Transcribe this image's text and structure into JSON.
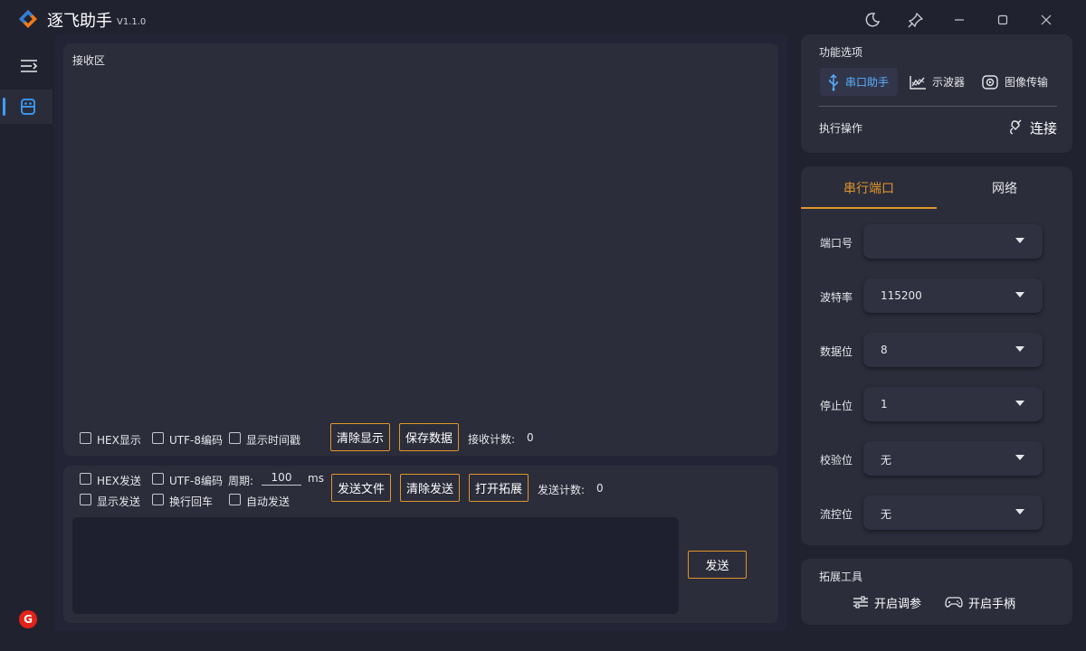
{
  "window": {
    "title": "逐飞助手",
    "version": "V1.1.0"
  },
  "receive": {
    "title": "接收区",
    "options": [
      {
        "label": "HEX显示",
        "checked": false
      },
      {
        "label": "UTF-8编码",
        "checked": false
      },
      {
        "label": "显示时间戳",
        "checked": false
      }
    ],
    "clear_button": "清除显示",
    "save_button": "保存数据",
    "count_label": "接收计数:",
    "count_value": "0"
  },
  "send": {
    "options_row1": [
      {
        "label": "HEX发送",
        "checked": false
      },
      {
        "label": "UTF-8编码",
        "checked": false
      }
    ],
    "period_label": "周期:",
    "period_value": "100",
    "period_unit": "ms",
    "options_row2": [
      {
        "label": "显示发送",
        "checked": false
      },
      {
        "label": "换行回车",
        "checked": false
      },
      {
        "label": "自动发送",
        "checked": false
      }
    ],
    "send_file_button": "发送文件",
    "clear_send_button": "清除发送",
    "open_ext_button": "打开拓展",
    "count_label": "发送计数:",
    "count_value": "0",
    "send_button": "发送",
    "input_value": ""
  },
  "functions": {
    "title": "功能选项",
    "tabs": [
      "串口助手",
      "示波器",
      "图像传输"
    ],
    "active_tab": "串口助手",
    "action_label": "执行操作",
    "connect_button": "连接"
  },
  "settings": {
    "tabs": [
      "串行端口",
      "网络"
    ],
    "active_tab": "串行端口",
    "fields": [
      {
        "label": "端口号",
        "value": ""
      },
      {
        "label": "波特率",
        "value": "115200"
      },
      {
        "label": "数据位",
        "value": "8"
      },
      {
        "label": "停止位",
        "value": "1"
      },
      {
        "label": "校验位",
        "value": "无"
      },
      {
        "label": "流控位",
        "value": "无"
      }
    ]
  },
  "extensions": {
    "title": "拓展工具",
    "tuning_button": "开启调参",
    "gamepad_button": "开启手柄"
  },
  "colors": {
    "accent_orange": "#e0952a",
    "accent_blue": "#58b0ff",
    "brand_red": "#e2231a"
  }
}
